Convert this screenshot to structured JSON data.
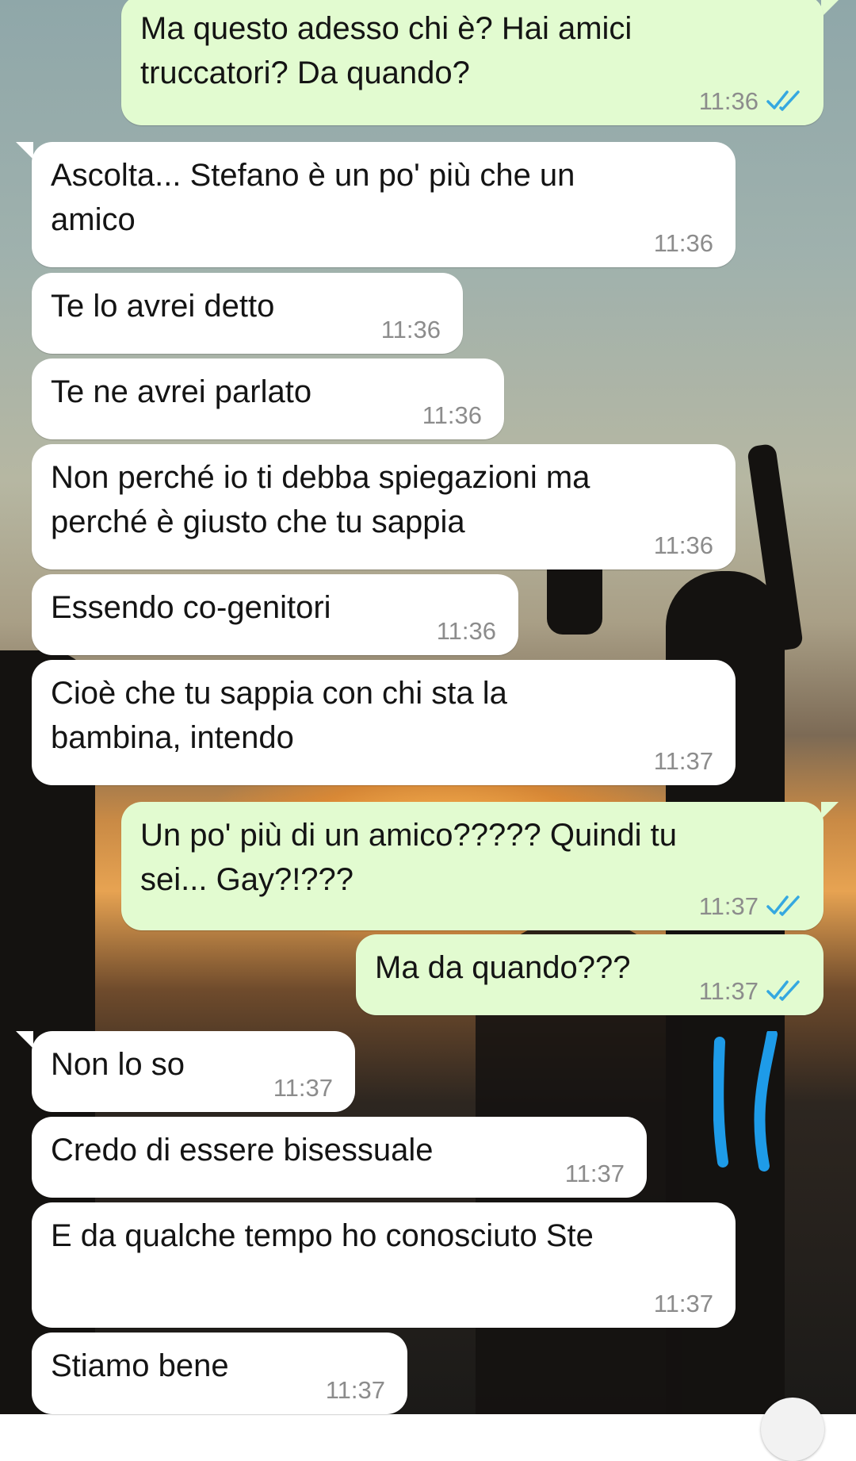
{
  "colors": {
    "incoming_bubble": "#ffffff",
    "outgoing_bubble": "#e2fbd0",
    "read_ticks": "#35a8e0",
    "annotation_marker": "#1e9be8"
  },
  "messages": [
    {
      "dir": "out",
      "text": "Ma questo adesso chi è? Hai amici\ntruccatori? Da quando?",
      "time": "11:36",
      "status": "read"
    },
    {
      "dir": "in",
      "text": "Ascolta... Stefano è un po' più che un\namico",
      "time": "11:36"
    },
    {
      "dir": "in",
      "text": "Te lo avrei detto",
      "time": "11:36"
    },
    {
      "dir": "in",
      "text": "Te ne avrei parlato",
      "time": "11:36"
    },
    {
      "dir": "in",
      "text": "Non perché io ti debba spiegazioni ma\nperché è giusto che tu sappia",
      "time": "11:36"
    },
    {
      "dir": "in",
      "text": "Essendo co-genitori",
      "time": "11:36"
    },
    {
      "dir": "in",
      "text": "Cioè che tu sappia con chi sta la\nbambina, intendo",
      "time": "11:37"
    },
    {
      "dir": "out",
      "text": "Un po' più di un amico????? Quindi tu\nsei... Gay?!???",
      "time": "11:37",
      "status": "read"
    },
    {
      "dir": "out",
      "text": "Ma da quando???",
      "time": "11:37",
      "status": "read"
    },
    {
      "dir": "in",
      "text": "Non lo so",
      "time": "11:37"
    },
    {
      "dir": "in",
      "text": "Credo di essere bisessuale",
      "time": "11:37"
    },
    {
      "dir": "in",
      "text": "E da qualche tempo ho conosciuto Ste",
      "time": "11:37"
    },
    {
      "dir": "in",
      "text": "Stiamo bene",
      "time": "11:37"
    }
  ]
}
